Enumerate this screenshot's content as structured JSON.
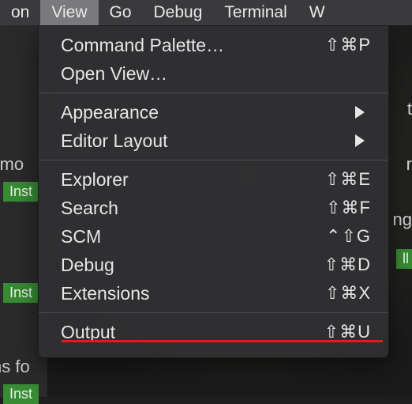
{
  "menubar": {
    "items": [
      {
        "label": "on",
        "selected": false
      },
      {
        "label": "View",
        "selected": true
      },
      {
        "label": "Go",
        "selected": false
      },
      {
        "label": "Debug",
        "selected": false
      },
      {
        "label": "Terminal",
        "selected": false
      },
      {
        "label": "W",
        "selected": false
      }
    ]
  },
  "dropdown": {
    "section1": [
      {
        "label": "Command Palette…",
        "shortcut": "⇧⌘P"
      },
      {
        "label": "Open View…",
        "shortcut": ""
      }
    ],
    "section2": [
      {
        "label": "Appearance",
        "submenu": true
      },
      {
        "label": "Editor Layout",
        "submenu": true
      }
    ],
    "section3": [
      {
        "label": "Explorer",
        "shortcut": "⇧⌘E"
      },
      {
        "label": "Search",
        "shortcut": "⇧⌘F"
      },
      {
        "label": "SCM",
        "shortcut": "⌃⇧G"
      },
      {
        "label": "Debug",
        "shortcut": "⇧⌘D"
      },
      {
        "label": "Extensions",
        "shortcut": "⇧⌘X"
      }
    ],
    "section4": [
      {
        "label": "Output",
        "shortcut": "⇧⌘U"
      }
    ]
  },
  "background": {
    "frag_remote": "remo",
    "frag_nsfo": "ns fo",
    "install1": "Inst",
    "install2": "Inst",
    "install3": "Inst",
    "right_t": "t",
    "right_r": "r",
    "right_ng": "ng",
    "right_badge": "ll"
  }
}
